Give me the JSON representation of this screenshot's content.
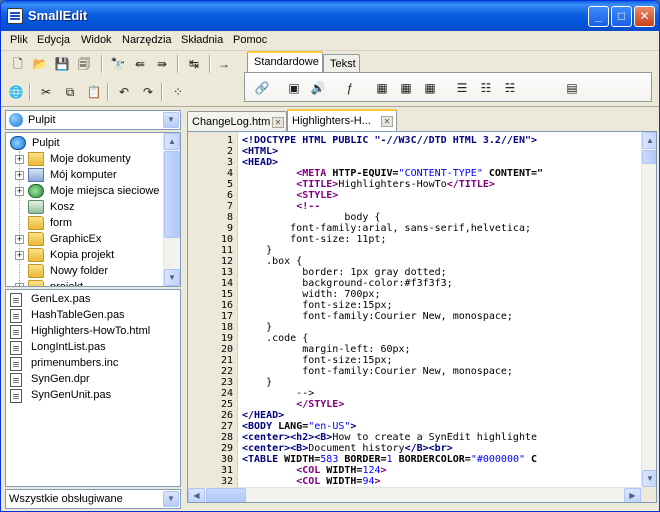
{
  "window": {
    "title": "SmallEdit",
    "min": "_",
    "max": "□",
    "close": "✕"
  },
  "menu": [
    "Plik",
    "Edycja",
    "Widok",
    "Narzędzia",
    "Składnia",
    "Pomoc"
  ],
  "toolbar": {
    "row1": [
      {
        "name": "new-icon",
        "glyph": "🗋"
      },
      {
        "name": "open-folder-icon",
        "glyph": "📂"
      },
      {
        "name": "save-icon",
        "glyph": "💾"
      },
      {
        "name": "save-all-icon",
        "glyph": "🗐"
      },
      {
        "name": "find-icon",
        "glyph": "🔭"
      },
      {
        "name": "find-prev-icon",
        "glyph": "⇚"
      },
      {
        "name": "find-next-icon",
        "glyph": "⇛"
      },
      {
        "name": "replace-icon",
        "glyph": "↹"
      },
      {
        "name": "goto-arrow-icon",
        "glyph": "→"
      }
    ],
    "row2": [
      {
        "name": "globe-icon",
        "glyph": "🌐"
      },
      {
        "name": "cut-icon",
        "glyph": "✂"
      },
      {
        "name": "copy-icon",
        "glyph": "⧉"
      },
      {
        "name": "paste-icon",
        "glyph": "📋"
      },
      {
        "name": "undo-icon",
        "glyph": "↶"
      },
      {
        "name": "redo-icon",
        "glyph": "↷"
      },
      {
        "name": "palette-icon",
        "glyph": "⁘"
      }
    ],
    "tabs": [
      "Standardowe",
      "Tekst"
    ],
    "tab_icons": [
      {
        "name": "link-icon",
        "glyph": "🔗"
      },
      {
        "name": "image-icon",
        "glyph": "▣"
      },
      {
        "name": "sound-icon",
        "glyph": "🔊"
      },
      {
        "name": "flash-icon",
        "glyph": "ƒ"
      },
      {
        "name": "table-icon",
        "glyph": "▦"
      },
      {
        "name": "table-row-icon",
        "glyph": "▦"
      },
      {
        "name": "table-cell-icon",
        "glyph": "▦"
      },
      {
        "name": "unordered-list-icon",
        "glyph": "☰"
      },
      {
        "name": "ordered-list-icon",
        "glyph": "☷"
      },
      {
        "name": "definition-list-icon",
        "glyph": "☵"
      },
      {
        "name": "form-icon",
        "glyph": "▤"
      }
    ]
  },
  "location_combo": {
    "value": "Pulpit",
    "arrow": "▼"
  },
  "tree": [
    {
      "label": "Pulpit",
      "icon": "desktop",
      "level": 0,
      "exp": ""
    },
    {
      "label": "Moje dokumenty",
      "icon": "docs",
      "level": 1,
      "exp": "+"
    },
    {
      "label": "Mój komputer",
      "icon": "pc",
      "level": 1,
      "exp": "+"
    },
    {
      "label": "Moje miejsca sieciowe",
      "icon": "net",
      "level": 1,
      "exp": "+"
    },
    {
      "label": "Kosz",
      "icon": "bin",
      "level": 1,
      "exp": ""
    },
    {
      "label": "form",
      "icon": "folder",
      "level": 1,
      "exp": ""
    },
    {
      "label": "GraphicEx",
      "icon": "folder",
      "level": 1,
      "exp": "+"
    },
    {
      "label": "Kopia projekt",
      "icon": "folder",
      "level": 1,
      "exp": "+"
    },
    {
      "label": "Nowy folder",
      "icon": "folder",
      "level": 1,
      "exp": ""
    },
    {
      "label": "projekt",
      "icon": "folder",
      "level": 1,
      "exp": "+"
    }
  ],
  "files": [
    "GenLex.pas",
    "HashTableGen.pas",
    "Highlighters-HowTo.html",
    "LongIntList.pas",
    "primenumbers.inc",
    "SynGen.dpr",
    "SynGenUnit.pas"
  ],
  "filter_combo": {
    "value": "Wszystkie obsługiwane",
    "arrow": "▼"
  },
  "editor_tabs": [
    {
      "label": "ChangeLog.htm",
      "active": false
    },
    {
      "label": "Highlighters-H...",
      "active": true
    }
  ],
  "tab_close": "✕",
  "scroll": {
    "up": "▲",
    "down": "▼",
    "left": "◀",
    "right": "▶"
  },
  "code_lines": [
    [
      [
        "t-tag",
        "<!DOCTYPE HTML PUBLIC "
      ],
      [
        "t-tag",
        "\"-//W3C//DTD HTML 3.2//EN\""
      ],
      [
        "t-tag",
        ">"
      ]
    ],
    [
      [
        "t-tag",
        "<HTML>"
      ]
    ],
    [
      [
        "t-tag",
        "<HEAD>"
      ]
    ],
    [
      [
        "t-txt",
        "         "
      ],
      [
        "t-tagp",
        "<META"
      ],
      [
        "t-attr",
        " HTTP-EQUIV="
      ],
      [
        "t-str",
        "\"CONTENT-TYPE\""
      ],
      [
        "t-attr",
        " CONTENT=\""
      ]
    ],
    [
      [
        "t-txt",
        "         "
      ],
      [
        "t-tagp",
        "<TITLE>"
      ],
      [
        "t-txt",
        "Highlighters-HowTo"
      ],
      [
        "t-tagp",
        "</TITLE>"
      ]
    ],
    [
      [
        "t-txt",
        "         "
      ],
      [
        "t-tagp",
        "<STYLE>"
      ]
    ],
    [
      [
        "t-txt",
        "         "
      ],
      [
        "t-tagp",
        "<!--"
      ]
    ],
    [
      [
        "t-css",
        "                 body {"
      ]
    ],
    [
      [
        "t-css",
        "        font-family:arial, sans-serif,helvetica;"
      ]
    ],
    [
      [
        "t-css",
        "        font-size: 11pt;"
      ]
    ],
    [
      [
        "t-css",
        "    }"
      ]
    ],
    [
      [
        "t-css",
        "    .box {"
      ]
    ],
    [
      [
        "t-css",
        "          border: 1px gray dotted;"
      ]
    ],
    [
      [
        "t-css",
        "          background-color:#f3f3f3;"
      ]
    ],
    [
      [
        "t-css",
        "          width: 700px;"
      ]
    ],
    [
      [
        "t-css",
        "          font-size:15px;"
      ]
    ],
    [
      [
        "t-css",
        "          font-family:Courier New, monospace;"
      ]
    ],
    [
      [
        "t-css",
        "    }"
      ]
    ],
    [
      [
        "t-css",
        "    .code {"
      ]
    ],
    [
      [
        "t-css",
        "          margin-left: 60px;"
      ]
    ],
    [
      [
        "t-css",
        "          font-size:15px;"
      ]
    ],
    [
      [
        "t-css",
        "          font-family:Courier New, monospace;"
      ]
    ],
    [
      [
        "t-css",
        "    }"
      ]
    ],
    [
      [
        "t-css",
        "         -->"
      ]
    ],
    [
      [
        "t-txt",
        "         "
      ],
      [
        "t-tagp",
        "</STYLE>"
      ]
    ],
    [
      [
        "t-tag",
        "</HEAD>"
      ]
    ],
    [
      [
        "t-tag",
        "<BODY"
      ],
      [
        "t-attr",
        " LANG="
      ],
      [
        "t-str",
        "\"en-US\""
      ],
      [
        "t-tag",
        ">"
      ]
    ],
    [
      [
        "t-tag",
        "<center><h2><B>"
      ],
      [
        "t-txt",
        "How to create a SynEdit highlighte"
      ]
    ],
    [
      [
        "t-tag",
        "<center><B>"
      ],
      [
        "t-txt",
        "Document history"
      ],
      [
        "t-tag",
        "</B><br>"
      ]
    ],
    [
      [
        "t-tag",
        "<TABLE"
      ],
      [
        "t-attr",
        " WIDTH="
      ],
      [
        "t-str",
        "583"
      ],
      [
        "t-attr",
        " BORDER="
      ],
      [
        "t-str",
        "1"
      ],
      [
        "t-attr",
        " BORDERCOLOR="
      ],
      [
        "t-str",
        "\"#000000\""
      ],
      [
        "t-attr",
        " C"
      ]
    ],
    [
      [
        "t-txt",
        "         "
      ],
      [
        "t-tagp",
        "<COL"
      ],
      [
        "t-attr",
        " WIDTH="
      ],
      [
        "t-str",
        "124"
      ],
      [
        "t-tagp",
        ">"
      ]
    ],
    [
      [
        "t-txt",
        "         "
      ],
      [
        "t-tagp",
        "<COL"
      ],
      [
        "t-attr",
        " WIDTH="
      ],
      [
        "t-str",
        "94"
      ],
      [
        "t-tagp",
        ">"
      ]
    ]
  ],
  "line_numbers": [
    "1",
    "2",
    "3",
    "4",
    "5",
    "6",
    "7",
    "8",
    "9",
    "10",
    "11",
    "12",
    "13",
    "14",
    "15",
    "16",
    "17",
    "18",
    "19",
    "20",
    "21",
    "22",
    "23",
    "24",
    "25",
    "26",
    "27",
    "28",
    "29",
    "30",
    "31",
    "32"
  ]
}
